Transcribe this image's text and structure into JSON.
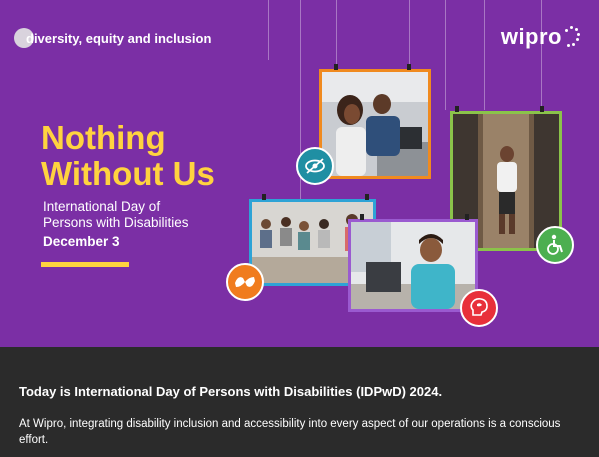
{
  "brand": {
    "dei_label": "diversity, equity and inclusion",
    "company": "wipro"
  },
  "hero": {
    "headline_line1": "Nothing",
    "headline_line2": "Without Us",
    "subtitle_line1": "International Day of",
    "subtitle_line2": "Persons with Disabilities",
    "date": "December 3"
  },
  "icons": {
    "vision": "eye-slash-icon",
    "wheelchair": "wheelchair-icon",
    "sign_language": "sign-language-icon",
    "speech": "speech-head-icon"
  },
  "colors": {
    "banner": "#7b2fa5",
    "accent_yellow": "#ffd33f",
    "footer": "#2b2b2b"
  },
  "message": {
    "title": "Today is International Day of Persons with Disabilities (IDPwD) 2024.",
    "body": "At Wipro, integrating disability inclusion and accessibility into every aspect of our operations is a conscious effort."
  }
}
